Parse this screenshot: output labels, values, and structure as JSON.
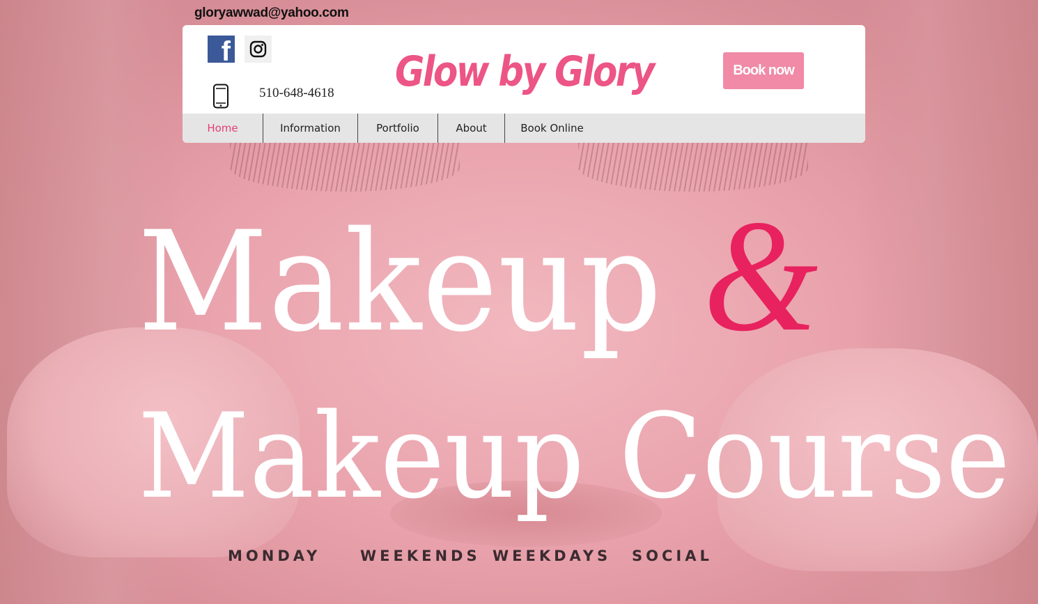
{
  "contact": {
    "email": "gloryawwad@yahoo.com",
    "phone": "510-648-4618"
  },
  "header": {
    "brand": "Glow by Glory",
    "book_button": "Book now",
    "social": {
      "facebook_icon": "facebook-icon",
      "instagram_icon": "instagram-icon"
    }
  },
  "nav": {
    "items": [
      {
        "label": "Home",
        "active": true
      },
      {
        "label": "Information"
      },
      {
        "label": "Portfolio"
      },
      {
        "label": "About"
      },
      {
        "label": "Book Online"
      }
    ]
  },
  "hero": {
    "line1": "Makeup",
    "ampersand": "&",
    "line2": "Makeup Course"
  },
  "schedule": {
    "items": [
      "MONDAY",
      "WEEKENDS",
      "WEEKDAYS",
      "SOCIAL"
    ]
  },
  "colors": {
    "brand_pink": "#ec5586",
    "button_pink": "#f08aa7",
    "nav_active": "#e33f75",
    "ampersand": "#e8225f",
    "nav_background": "#e5e5e5"
  }
}
